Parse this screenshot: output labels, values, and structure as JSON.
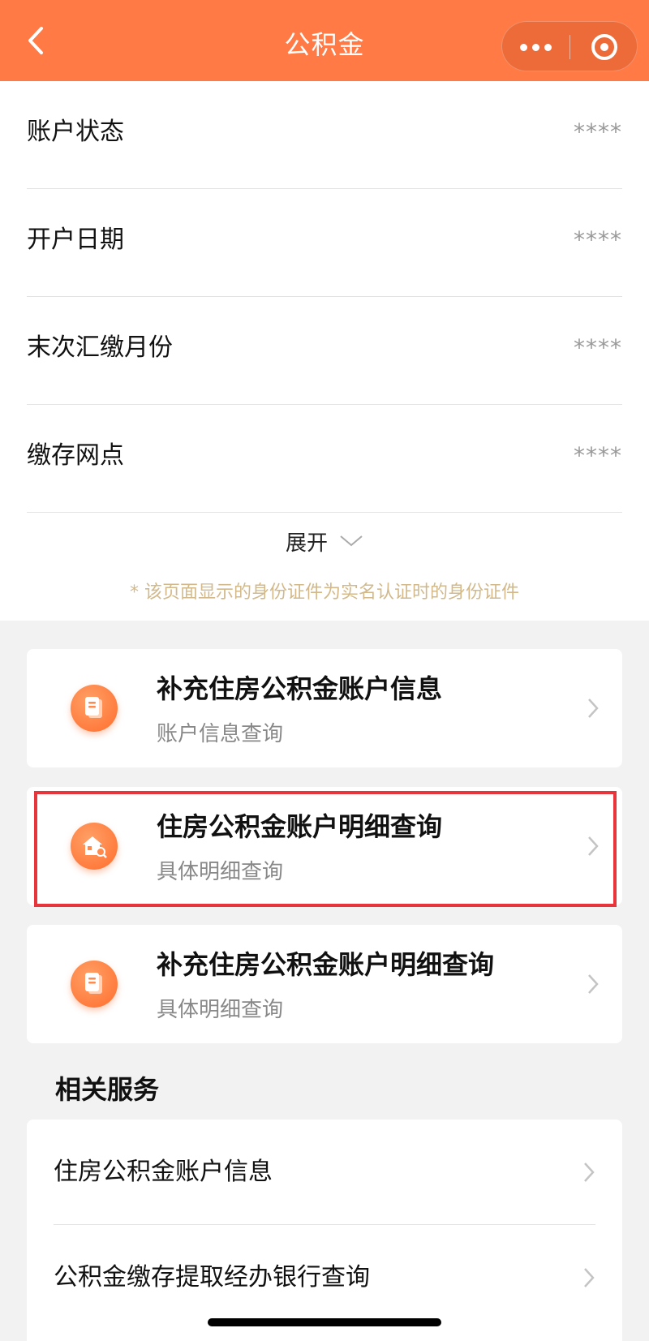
{
  "header": {
    "title": "公积金",
    "back_icon": "chevron-left-icon",
    "more_icon": "more-dots-icon",
    "close_icon": "target-circle-icon",
    "background": "#ff7a45"
  },
  "account_info": [
    {
      "label": "账户状态",
      "value": "****"
    },
    {
      "label": "开户日期",
      "value": "****"
    },
    {
      "label": "末次汇缴月份",
      "value": "****"
    },
    {
      "label": "缴存网点",
      "value": "****"
    }
  ],
  "expand": {
    "label": "展开",
    "icon": "chevron-down-icon"
  },
  "note": "* 该页面显示的身份证件为实名认证时的身份证件",
  "cards": [
    {
      "title": "补充住房公积金账户信息",
      "subtitle": "账户信息查询",
      "icon": "document-icon"
    },
    {
      "title": "住房公积金账户明细查询",
      "subtitle": "具体明细查询",
      "icon": "house-search-icon",
      "highlighted": true
    },
    {
      "title": "补充住房公积金账户明细查询",
      "subtitle": "具体明细查询",
      "icon": "document-icon"
    }
  ],
  "related": {
    "title": "相关服务",
    "items": [
      {
        "label": "住房公积金账户信息"
      },
      {
        "label": "公积金缴存提取经办银行查询"
      }
    ]
  },
  "colors": {
    "accent": "#ff7a45",
    "highlight_border": "#e8353b",
    "note": "#d3b98a"
  }
}
